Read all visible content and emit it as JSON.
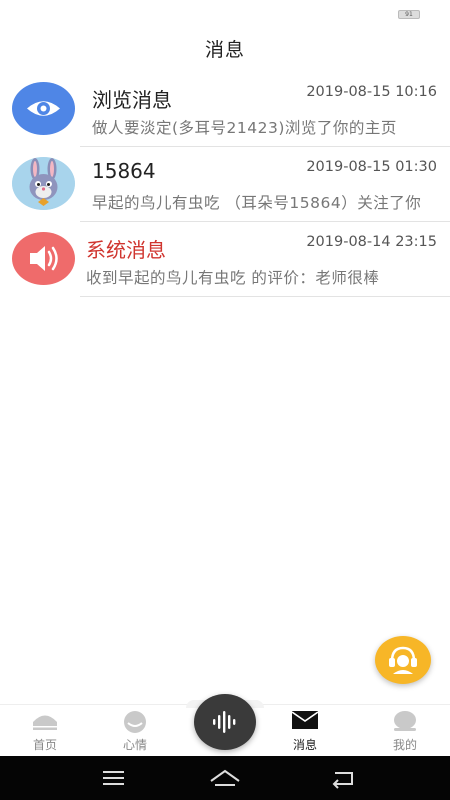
{
  "status_bar": {
    "battery_label": "91"
  },
  "header": {
    "title": "消息"
  },
  "messages": [
    {
      "name": "浏览消息",
      "time": "2019-08-15 10:16",
      "preview": "做人要淡定(多耳号21423)浏览了你的主页",
      "avatar_icon": "eye-icon",
      "avatar_color": "#4f86e6"
    },
    {
      "name": "15864",
      "time": "2019-08-15 01:30",
      "preview": "早起的鸟儿有虫吃 （耳朵号15864）关注了你",
      "avatar_icon": "rabbit-avatar"
    },
    {
      "name": "系统消息",
      "time": "2019-08-14 23:15",
      "preview": "收到早起的鸟儿有虫吃 的评价：老师很棒",
      "avatar_icon": "speaker-icon",
      "avatar_color": "#ef6b6b",
      "name_color": "#d0352f"
    }
  ],
  "tabs": [
    {
      "label": "首页",
      "icon": "home-icon"
    },
    {
      "label": "心情",
      "icon": "mood-icon"
    },
    {
      "label": "",
      "icon": "voice-wave-icon"
    },
    {
      "label": "消息",
      "icon": "mail-icon",
      "active": true
    },
    {
      "label": "我的",
      "icon": "profile-icon"
    }
  ],
  "fab": {
    "icon": "customer-service-icon",
    "color": "#f7b627"
  },
  "system_nav": [
    "menu-icon",
    "home-outline-icon",
    "back-icon"
  ]
}
